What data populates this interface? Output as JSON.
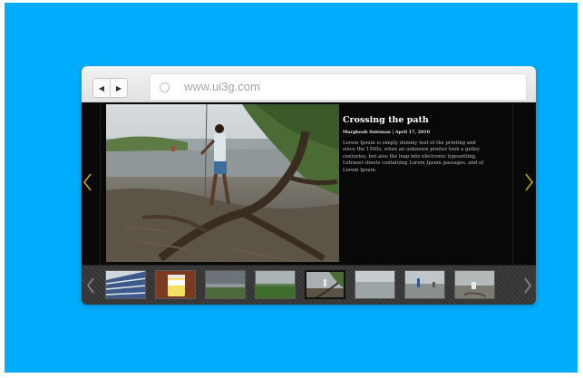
{
  "browser": {
    "url": "www.ui3g.com",
    "back_icon": "left-triangle-icon",
    "forward_icon": "right-triangle-icon"
  },
  "slide": {
    "title": "Crossing the path",
    "author": "Marghoob Suleman",
    "date": "April 17, 2010",
    "separator": "|",
    "body": "Lorem Ipsum is simply dummy text of the printing and since the 1500s, when an unknown printer took a galley centuries, but also the leap into electronic typesetting, Letraset sheets containing Lorem Ipsum passages, and of Lorem Ipsum."
  },
  "thumbnails": {
    "count": 8,
    "active_index": 5
  },
  "colors": {
    "background": "#00adfc",
    "arrow": "#c8a800",
    "stage": "#080808"
  }
}
